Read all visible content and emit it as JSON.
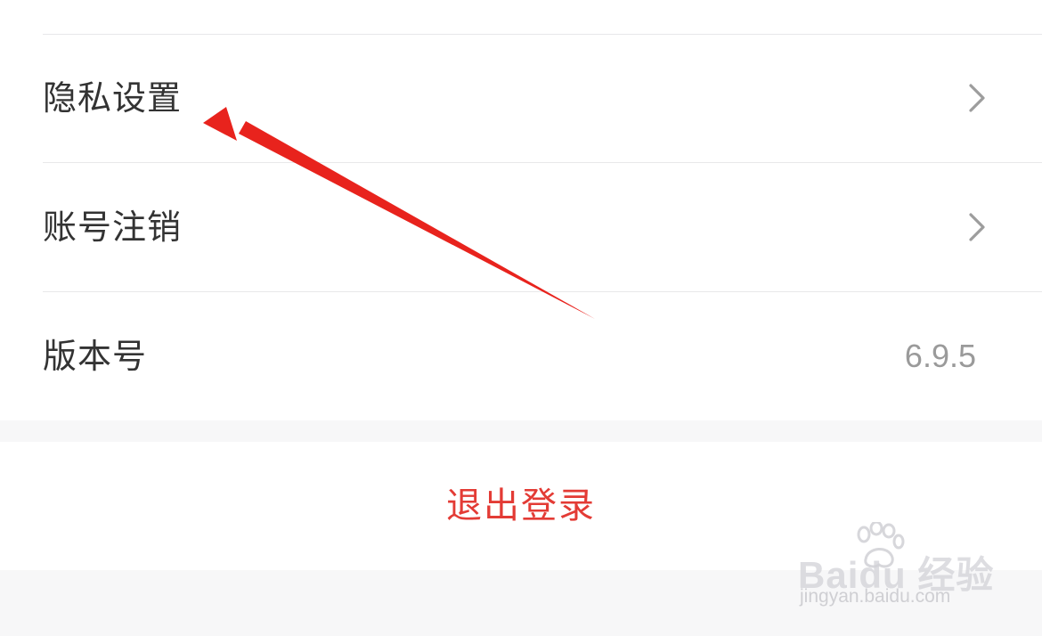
{
  "settings": {
    "rows": [
      {
        "label": "隐私设置",
        "icon": "chevron-right-icon"
      },
      {
        "label": "账号注销",
        "icon": "chevron-right-icon"
      },
      {
        "label": "版本号",
        "value": "6.9.5"
      }
    ]
  },
  "logout": {
    "label": "退出登录"
  },
  "watermark": {
    "brand": "Baidu 经验",
    "url": "jingyan.baidu.com"
  },
  "colors": {
    "text_primary": "#333333",
    "text_secondary": "#9a9a9a",
    "logout_red": "#e33b35",
    "annotation_red": "#e8231d",
    "background": "#f7f7f8",
    "card": "#ffffff",
    "divider": "#e8e8ea"
  }
}
